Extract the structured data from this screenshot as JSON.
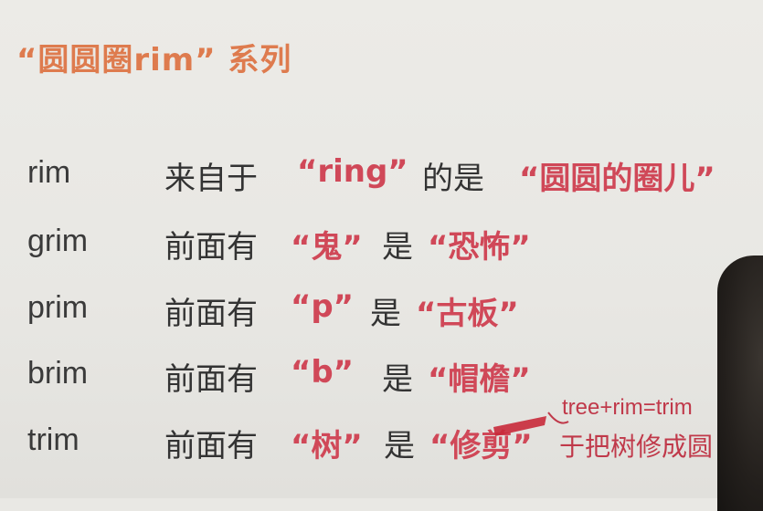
{
  "title": "“圆圆圈rim” 系列",
  "rows": [
    {
      "word": "rim",
      "prefix": "来自于",
      "part": "“ring”",
      "link": "的是",
      "meaning": "“圆圆的圈儿”"
    },
    {
      "word": "grim",
      "prefix": "前面有",
      "part": "“鬼”",
      "link": "是",
      "meaning": "“恐怖”"
    },
    {
      "word": "prim",
      "prefix": "前面有",
      "part": "“p”",
      "link": "是",
      "meaning": "“古板”"
    },
    {
      "word": "brim",
      "prefix": "前面有",
      "part": "“b”",
      "link": "是",
      "meaning": "“帽檐”"
    },
    {
      "word": "trim",
      "prefix": "前面有",
      "part": "“树”",
      "link": "是",
      "meaning": "“修剪”"
    }
  ],
  "annotation": {
    "formula": "tree+rim=trim",
    "explanation": "于把树修成圆"
  },
  "colors": {
    "title": "#de7b4e",
    "highlight": "#d04858",
    "annotation": "#c0394a"
  }
}
